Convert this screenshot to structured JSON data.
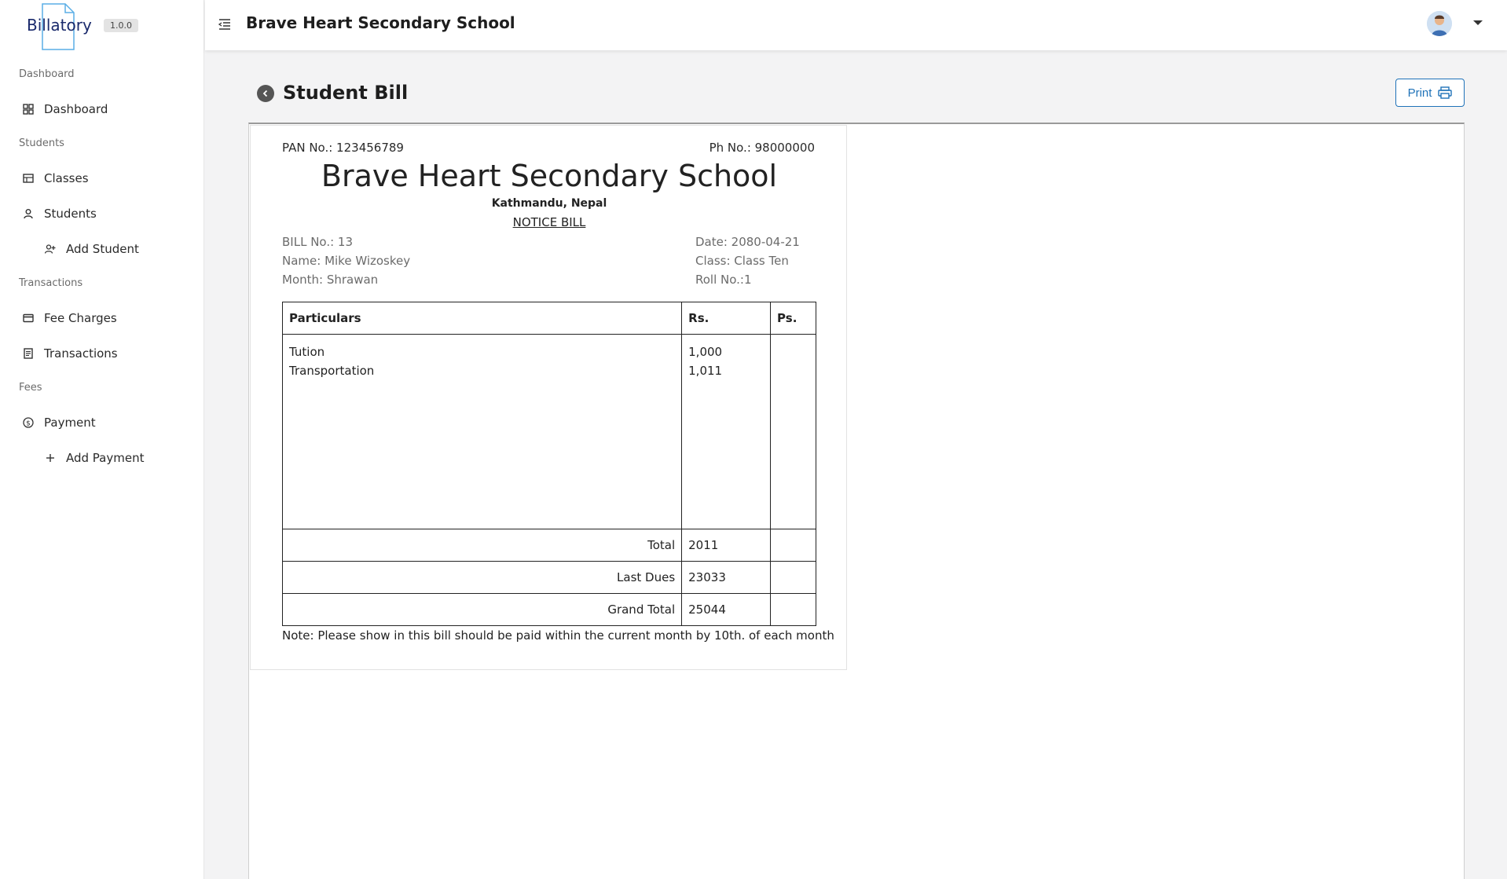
{
  "app": {
    "brand_name": "Billatory",
    "version": "1.0.0"
  },
  "sidebar": {
    "sections": [
      {
        "label": "Dashboard"
      },
      {
        "label": "Students"
      },
      {
        "label": "Transactions"
      },
      {
        "label": "Fees"
      }
    ],
    "items": [
      {
        "label": "Dashboard",
        "icon": "dashboard-icon"
      },
      {
        "label": "Classes",
        "icon": "classes-icon"
      },
      {
        "label": "Students",
        "icon": "user-icon"
      },
      {
        "label": "Add Student",
        "icon": "add-user-icon"
      },
      {
        "label": "Fee Charges",
        "icon": "card-icon"
      },
      {
        "label": "Transactions",
        "icon": "document-icon"
      },
      {
        "label": "Payment",
        "icon": "dollar-icon"
      },
      {
        "label": "Add Payment",
        "icon": "plus-icon"
      }
    ]
  },
  "topbar": {
    "title": "Brave Heart Secondary School"
  },
  "page": {
    "title": "Student Bill",
    "print_label": "Print"
  },
  "bill": {
    "pan": "PAN No.: 123456789",
    "phone": "Ph No.: 98000000",
    "school": "Brave Heart Secondary School",
    "address": "Kathmandu, Nepal",
    "notice": "NOTICE BILL",
    "bill_no": "BILL No.: 13",
    "name": "Name: Mike Wizoskey",
    "month": "Month: Shrawan",
    "date": "Date: 2080-04-21",
    "class": "Class: Class Ten",
    "roll": "Roll No.:1",
    "headers": {
      "particulars": "Particulars",
      "rs": "Rs.",
      "ps": "Ps."
    },
    "items": [
      {
        "particular": "Tution",
        "rs": "1,000"
      },
      {
        "particular": "Transportation",
        "rs": "1,011"
      }
    ],
    "totals": [
      {
        "label": "Total",
        "rs": "2011"
      },
      {
        "label": "Last Dues",
        "rs": "23033"
      },
      {
        "label": "Grand Total",
        "rs": "25044"
      }
    ],
    "note": "Note: Please show in this bill should be paid within the current month by 10th. of each month"
  }
}
